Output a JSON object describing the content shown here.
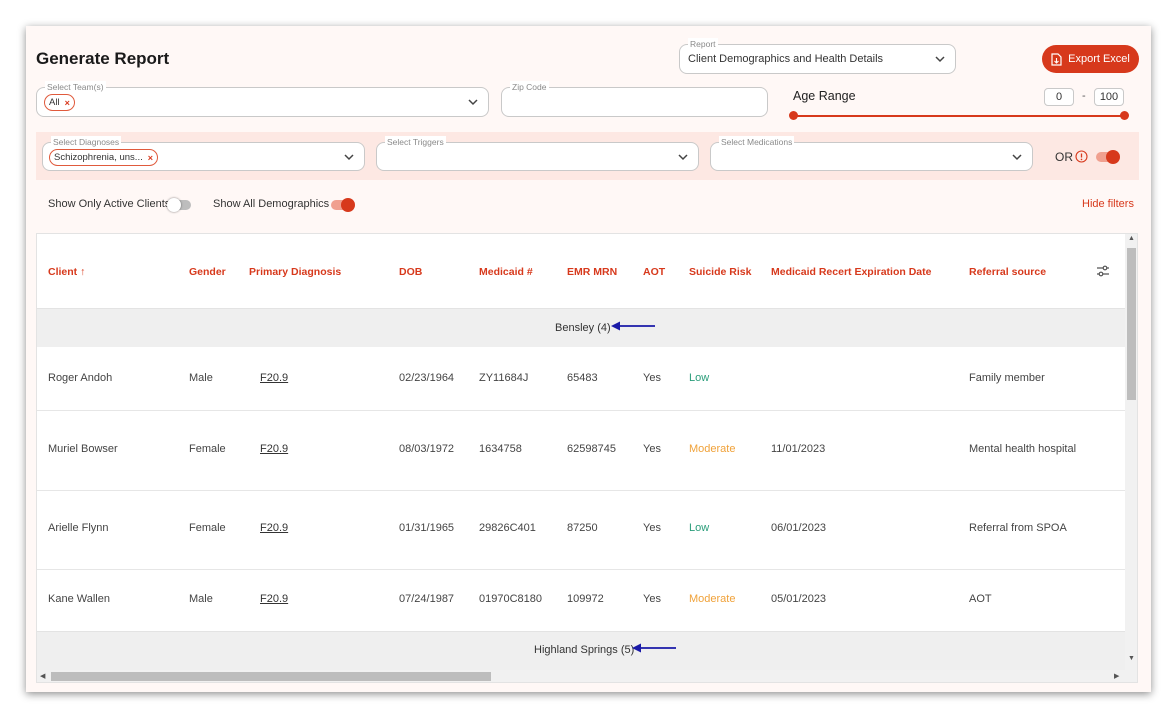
{
  "page": {
    "title": "Generate Report",
    "export_label": "Export Excel",
    "hide_filters_label": "Hide filters"
  },
  "filters": {
    "report": {
      "label": "Report",
      "value": "Client Demographics and Health Details"
    },
    "teams": {
      "label": "Select Team(s)",
      "chip": "All"
    },
    "zip": {
      "label": "Zip Code",
      "value": ""
    },
    "age_range": {
      "label": "Age Range",
      "min": "0",
      "max": "100",
      "separator": "-"
    },
    "diagnoses": {
      "label": "Select Diagnoses",
      "chip": "Schizophrenia, uns..."
    },
    "triggers": {
      "label": "Select Triggers",
      "value": ""
    },
    "medications": {
      "label": "Select Medications",
      "value": ""
    },
    "or_label": "OR",
    "or_toggle_on": true,
    "active_clients": {
      "label": "Show Only Active Clients",
      "on": false
    },
    "all_demographics": {
      "label": "Show All Demographics",
      "on": true
    }
  },
  "table": {
    "columns": [
      "Client",
      "Gender",
      "Primary Diagnosis",
      "DOB",
      "Medicaid #",
      "EMR MRN",
      "AOT",
      "Suicide Risk",
      "Medicaid Recert Expiration Date",
      "Referral source"
    ],
    "sort_indicator": "↑",
    "groups": [
      {
        "label": "Bensley (4)",
        "rows": [
          {
            "client": "Roger Andoh",
            "gender": "Male",
            "diagnosis": "F20.9",
            "dob": "02/23/1964",
            "medicaid": "ZY11684J",
            "emr": "65483",
            "aot": "Yes",
            "risk": "Low",
            "recert": "",
            "referral": "Family member"
          },
          {
            "client": "Muriel Bowser",
            "gender": "Female",
            "diagnosis": "F20.9",
            "dob": "08/03/1972",
            "medicaid": "1634758",
            "emr": "62598745",
            "aot": "Yes",
            "risk": "Moderate",
            "recert": "11/01/2023",
            "referral": "Mental health hospital"
          },
          {
            "client": "Arielle Flynn",
            "gender": "Female",
            "diagnosis": "F20.9",
            "dob": "01/31/1965",
            "medicaid": "29826C401",
            "emr": "87250",
            "aot": "Yes",
            "risk": "Low",
            "recert": "06/01/2023",
            "referral": "Referral from SPOA"
          },
          {
            "client": "Kane Wallen",
            "gender": "Male",
            "diagnosis": "F20.9",
            "dob": "07/24/1987",
            "medicaid": "01970C8180",
            "emr": "109972",
            "aot": "Yes",
            "risk": "Moderate",
            "recert": "05/01/2023",
            "referral": "AOT"
          }
        ]
      },
      {
        "label": "Highland Springs (5)",
        "rows": []
      }
    ]
  },
  "colors": {
    "accent": "#d7391c",
    "low_risk": "#2a9d7a",
    "moderate_risk": "#f0a23a",
    "annotation_arrow": "#1a1aa8"
  }
}
